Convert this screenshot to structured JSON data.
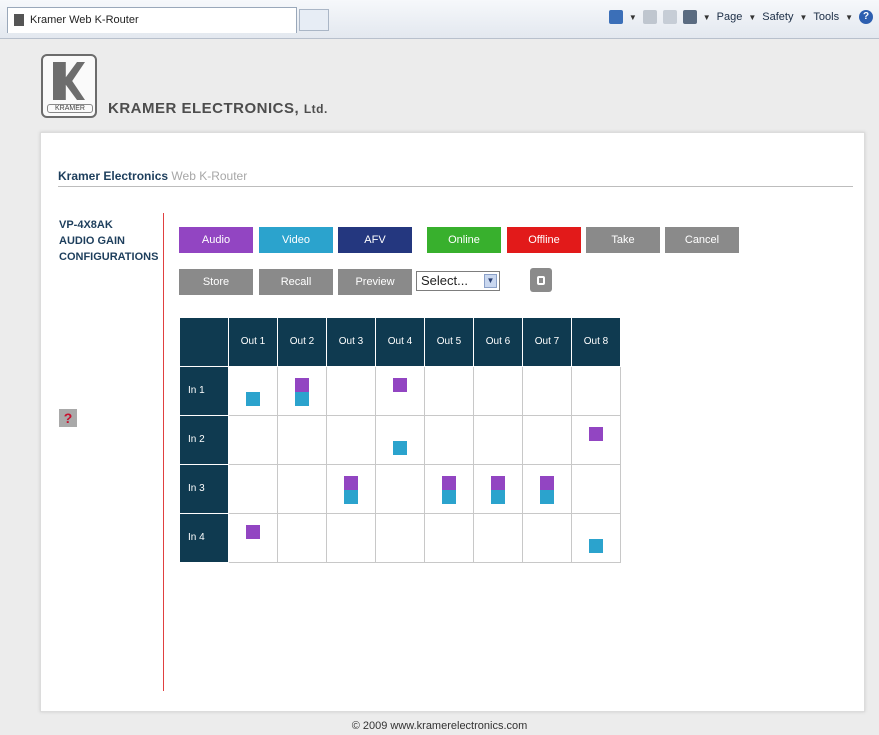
{
  "browser": {
    "tab_title": "Kramer Web K-Router",
    "commands": {
      "page": "Page",
      "safety": "Safety",
      "tools": "Tools"
    }
  },
  "header": {
    "logo_text": "KRAMER",
    "company": "KRAMER ELECTRONICS,",
    "company_suffix": "Ltd."
  },
  "breadcrumb": {
    "primary": "Kramer Electronics",
    "secondary": "Web K-Router"
  },
  "sidebar": {
    "items": [
      "VP-4X8AK",
      "AUDIO GAIN",
      "CONFIGURATIONS"
    ],
    "help": "?"
  },
  "toolbar": {
    "audio": "Audio",
    "video": "Video",
    "afv": "AFV",
    "online": "Online",
    "offline": "Offline",
    "take": "Take",
    "cancel": "Cancel",
    "store": "Store",
    "recall": "Recall",
    "preview": "Preview",
    "select_value": "Select..."
  },
  "matrix": {
    "outputs": [
      "Out 1",
      "Out 2",
      "Out 3",
      "Out 4",
      "Out 5",
      "Out 6",
      "Out 7",
      "Out 8"
    ],
    "inputs": [
      "In 1",
      "In 2",
      "In 3",
      "In 4"
    ]
  },
  "footer": "© 2009 www.kramerelectronics.com",
  "colors": {
    "audio": "#9245c2",
    "video": "#2ba3cd",
    "afv": "#24377f",
    "online": "#38b02d",
    "offline": "#e21a1a",
    "header": "#0f3a50"
  }
}
